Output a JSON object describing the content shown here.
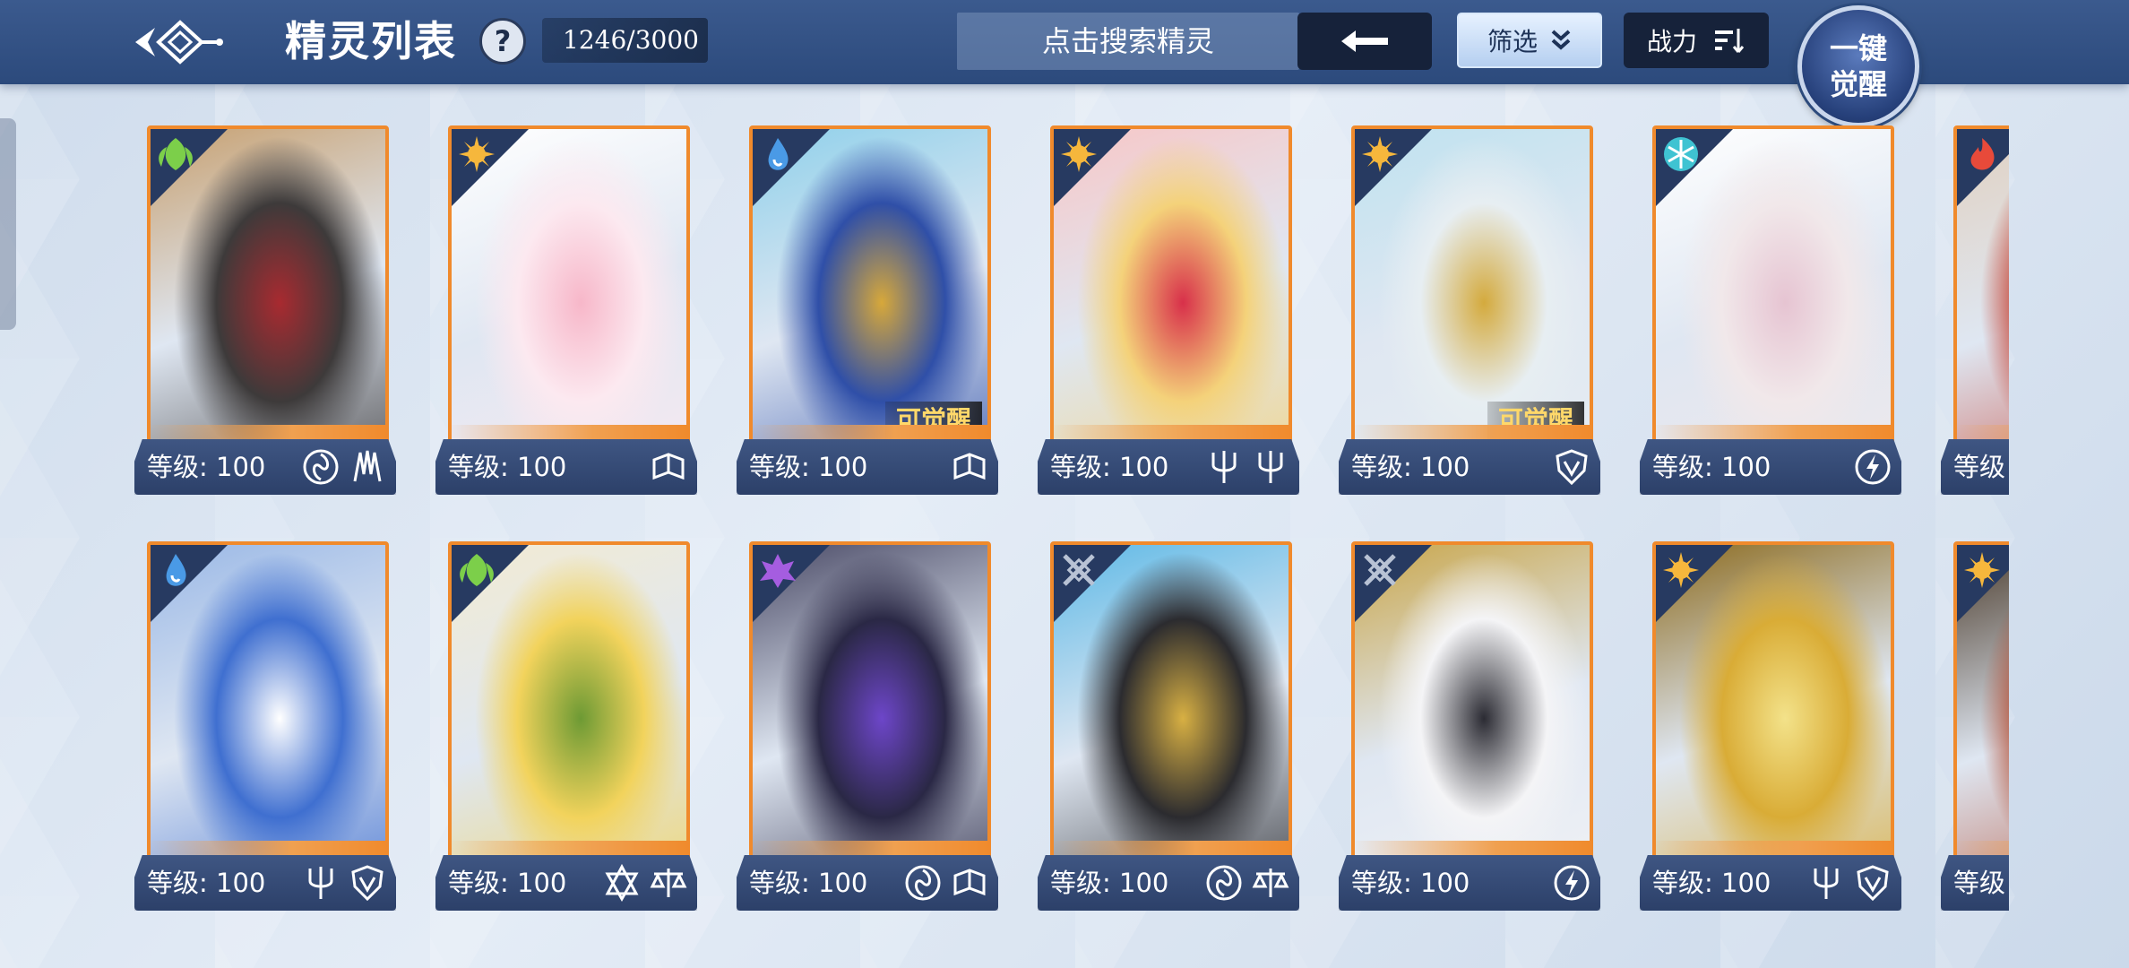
{
  "header": {
    "title": "精灵列表",
    "help": "?",
    "count": "1246/3000",
    "search_placeholder": "点击搜索精灵",
    "filter_label": "筛选",
    "sort_label": "战力",
    "awaken_line1": "一键",
    "awaken_line2": "觉醒"
  },
  "colors": {
    "topbar": "#2c4a7c",
    "card_border": "#f08a2c",
    "level_bar": "#344a76",
    "awaken_gold": "#ffd86a"
  },
  "cards": [
    {
      "element": "grass-element-icon",
      "elem_color": "#7ccf4a",
      "level": "等级: 100",
      "skills": [
        "spiral-skill-icon",
        "claw-skill-icon"
      ],
      "awaken": "",
      "art": [
        "#3d3a3a",
        "#a82a30",
        "#c7a070"
      ]
    },
    {
      "element": "light-element-icon",
      "elem_color": "#f6b73c",
      "level": "等级: 100",
      "skills": [
        "book-skill-icon"
      ],
      "awaken": "",
      "art": [
        "#fce9f0",
        "#f7b7c9",
        "#ffffff"
      ]
    },
    {
      "element": "water-element-icon",
      "elem_color": "#4a9ae6",
      "level": "等级: 100",
      "skills": [
        "book-skill-icon"
      ],
      "awaken": "可觉醒",
      "art": [
        "#2f4fa8",
        "#d7a83a",
        "#8fd0ea"
      ]
    },
    {
      "element": "light-element-icon",
      "elem_color": "#f6b73c",
      "level": "等级: 100",
      "skills": [
        "trident-skill-icon",
        "trident-skill-icon"
      ],
      "awaken": "",
      "art": [
        "#f4d27a",
        "#d8304a",
        "#f7c7c7"
      ]
    },
    {
      "element": "light-element-icon",
      "elem_color": "#f6b73c",
      "level": "等级: 100",
      "skills": [
        "shield-skill-icon"
      ],
      "awaken": "可觉醒",
      "art": [
        "#e7eef2",
        "#d4aa3d",
        "#bfe2ef"
      ]
    },
    {
      "element": "ice-element-icon",
      "elem_color": "#3fc3d2",
      "level": "等级: 100",
      "skills": [
        "lightning-skill-icon"
      ],
      "awaken": "",
      "art": [
        "#f1e8ea",
        "#e6c4d2",
        "#ffffff"
      ]
    },
    {
      "element": "fire-element-icon",
      "elem_color": "#e84a3a",
      "level": "等级",
      "skills": [],
      "awaken": "",
      "art": [
        "#c43a2a",
        "#3d2a2a",
        "#e0d0c0"
      ]
    },
    {
      "element": "water-element-icon",
      "elem_color": "#4a9ae6",
      "level": "等级: 100",
      "skills": [
        "trident-skill-icon",
        "shield-skill-icon"
      ],
      "awaken": "",
      "art": [
        "#3f6fd0",
        "#ffffff",
        "#9ab8e6"
      ]
    },
    {
      "element": "grass-element-icon",
      "elem_color": "#7ccf4a",
      "level": "等级: 100",
      "skills": [
        "star-skill-icon",
        "scale-skill-icon"
      ],
      "awaken": "",
      "art": [
        "#f2d35c",
        "#6d9a34",
        "#f2ebd3"
      ]
    },
    {
      "element": "dark-element-icon",
      "elem_color": "#a55de0",
      "level": "等级: 100",
      "skills": [
        "spiral-skill-icon",
        "book-skill-icon"
      ],
      "awaken": "",
      "art": [
        "#2a2845",
        "#6d46c9",
        "#4a4a66"
      ]
    },
    {
      "element": "neutral-element-icon",
      "elem_color": "#b8c2d4",
      "level": "等级: 100",
      "skills": [
        "spiral-skill-icon",
        "scale-skill-icon"
      ],
      "awaken": "",
      "art": [
        "#2b2b2f",
        "#d8b043",
        "#5eb9e6"
      ]
    },
    {
      "element": "neutral-element-icon",
      "elem_color": "#b8c2d4",
      "level": "等级: 100",
      "skills": [
        "lightning-skill-icon"
      ],
      "awaken": "",
      "art": [
        "#f4f4f6",
        "#2b2b33",
        "#c9a64a"
      ]
    },
    {
      "element": "light-element-icon",
      "elem_color": "#f6b73c",
      "level": "等级: 100",
      "skills": [
        "trident-skill-icon",
        "shield-skill-icon"
      ],
      "awaken": "",
      "art": [
        "#d9ac36",
        "#f3e28a",
        "#8c6b1f"
      ]
    },
    {
      "element": "light-element-icon",
      "elem_color": "#f6b73c",
      "level": "等级",
      "skills": [],
      "awaken": "",
      "art": [
        "#b0462a",
        "#e6d2b8",
        "#4a3a2a"
      ]
    }
  ]
}
